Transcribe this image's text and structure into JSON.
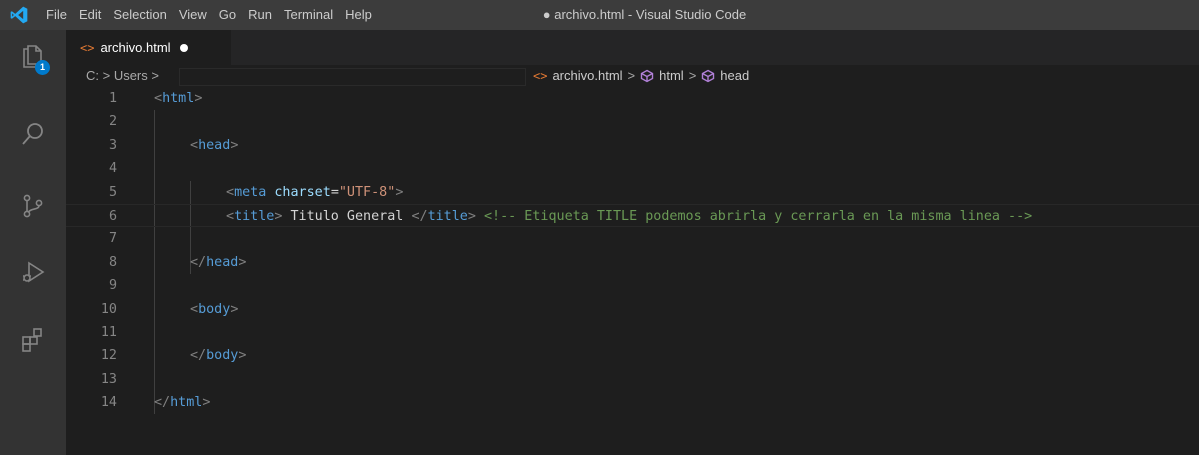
{
  "app": {
    "window_title": "● archivo.html - Visual Studio Code",
    "menu": [
      "File",
      "Edit",
      "Selection",
      "View",
      "Go",
      "Run",
      "Terminal",
      "Help"
    ]
  },
  "activity_bar": {
    "items": [
      {
        "icon": "files-icon",
        "badge": "1"
      },
      {
        "icon": "search-icon"
      },
      {
        "icon": "source-control-icon"
      },
      {
        "icon": "run-debug-icon"
      },
      {
        "icon": "extensions-icon"
      }
    ]
  },
  "tab": {
    "filename": "archivo.html",
    "modified": true
  },
  "breadcrumb": {
    "path_start": "C: > Users >",
    "file": "archivo.html",
    "symbols": [
      "html",
      "head"
    ]
  },
  "editor": {
    "lines": [
      {
        "n": "1",
        "tokens": [
          [
            "tg",
            "<"
          ],
          [
            "tn",
            "html"
          ],
          [
            "tg",
            ">"
          ]
        ],
        "indent": 0
      },
      {
        "n": "2",
        "tokens": [],
        "indent": 0
      },
      {
        "n": "3",
        "tokens": [
          [
            "tg",
            "<"
          ],
          [
            "tn",
            "head"
          ],
          [
            "tg",
            ">"
          ]
        ],
        "indent": 1
      },
      {
        "n": "4",
        "tokens": [],
        "indent": 0
      },
      {
        "n": "5",
        "tokens": [
          [
            "tg",
            "<"
          ],
          [
            "tn",
            "meta"
          ],
          [
            "tx",
            " "
          ],
          [
            "at",
            "charset"
          ],
          [
            "tx",
            "="
          ],
          [
            "st",
            "\"UTF-8\""
          ],
          [
            "tg",
            ">"
          ]
        ],
        "indent": 2
      },
      {
        "n": "6",
        "tokens": [
          [
            "tg",
            "<"
          ],
          [
            "tn",
            "title"
          ],
          [
            "tg",
            ">"
          ],
          [
            "tx",
            " Titulo General "
          ],
          [
            "tg",
            "</"
          ],
          [
            "tn",
            "title"
          ],
          [
            "tg",
            ">"
          ],
          [
            "tx",
            " "
          ],
          [
            "cm",
            "<!-- Etiqueta TITLE podemos abrirla y cerrarla en la misma linea -->"
          ]
        ],
        "indent": 2
      },
      {
        "n": "7",
        "tokens": [],
        "indent": 0
      },
      {
        "n": "8",
        "tokens": [
          [
            "tg",
            "</"
          ],
          [
            "tn",
            "head"
          ],
          [
            "tg",
            ">"
          ]
        ],
        "indent": 1
      },
      {
        "n": "9",
        "tokens": [],
        "indent": 0
      },
      {
        "n": "10",
        "tokens": [
          [
            "tg",
            "<"
          ],
          [
            "tn",
            "body"
          ],
          [
            "tg",
            ">"
          ]
        ],
        "indent": 1
      },
      {
        "n": "11",
        "tokens": [],
        "indent": 0
      },
      {
        "n": "12",
        "tokens": [
          [
            "tg",
            "</"
          ],
          [
            "tn",
            "body"
          ],
          [
            "tg",
            ">"
          ]
        ],
        "indent": 1
      },
      {
        "n": "13",
        "tokens": [],
        "indent": 0
      },
      {
        "n": "14",
        "tokens": [
          [
            "tg",
            "</"
          ],
          [
            "tn",
            "html"
          ],
          [
            "tg",
            ">"
          ]
        ],
        "indent": 0
      }
    ],
    "current_line": 6
  },
  "colors": {
    "tag_bracket": "#808080",
    "tag_name": "#569cd6",
    "attribute": "#9cdcfe",
    "string": "#ce9178",
    "comment": "#6a9955",
    "accent": "#007acc"
  }
}
